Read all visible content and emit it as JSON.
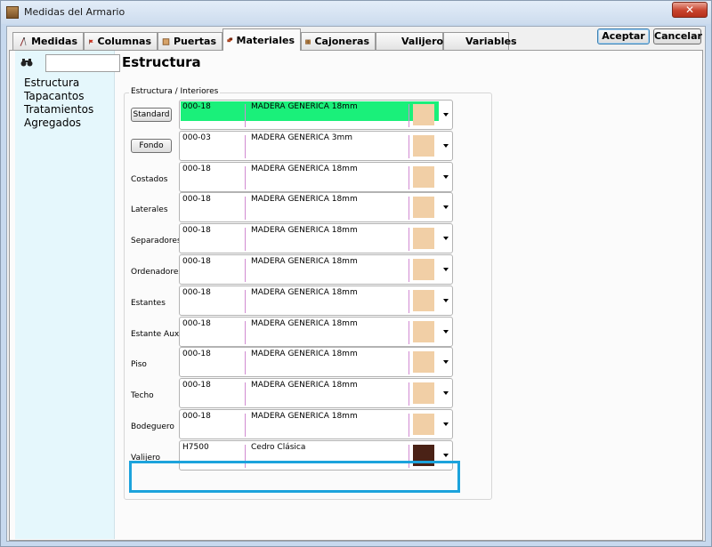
{
  "window": {
    "title": "Medidas del Armario",
    "close_glyph": "✕"
  },
  "tabs": [
    {
      "label": "Medidas",
      "icon": "compass-icon",
      "active": false
    },
    {
      "label": "Columnas",
      "icon": "flag-icon",
      "active": false
    },
    {
      "label": "Puertas",
      "icon": "door-icon",
      "active": false
    },
    {
      "label": "Materiales",
      "icon": "wood-icon",
      "active": true
    },
    {
      "label": "Cajoneras",
      "icon": "drawer-icon",
      "active": false
    },
    {
      "label": "Valijero",
      "icon": "",
      "active": false
    },
    {
      "label": "Variables",
      "icon": "",
      "active": false
    }
  ],
  "buttons": {
    "accept": "Aceptar",
    "cancel": "Cancelar"
  },
  "left_pane": {
    "search_icon": "binoculars-icon",
    "search_value": "",
    "tree_items": [
      "Estructura",
      "Tapacantos",
      "Tratamientos",
      "Agregados"
    ]
  },
  "section": {
    "title": "Estructura",
    "group_label": "Estructura / Interiores"
  },
  "rows": [
    {
      "label": "Standard",
      "is_button": true,
      "code": "000-18",
      "material": "MADERA GENERICA 18mm",
      "swatch": "#f1cfa6",
      "selected": true
    },
    {
      "label": "Fondo",
      "is_button": true,
      "code": "000-03",
      "material": "MADERA GENERICA 3mm",
      "swatch": "#f1cfa6",
      "selected": false
    },
    {
      "label": "Costados",
      "is_button": false,
      "code": "000-18",
      "material": "MADERA GENERICA 18mm",
      "swatch": "#f1cfa6",
      "selected": false
    },
    {
      "label": "Laterales",
      "is_button": false,
      "code": "000-18",
      "material": "MADERA GENERICA 18mm",
      "swatch": "#f1cfa6",
      "selected": false
    },
    {
      "label": "Separadores",
      "is_button": false,
      "code": "000-18",
      "material": "MADERA GENERICA 18mm",
      "swatch": "#f1cfa6",
      "selected": false
    },
    {
      "label": "Ordenadores",
      "is_button": false,
      "code": "000-18",
      "material": "MADERA GENERICA 18mm",
      "swatch": "#f1cfa6",
      "selected": false
    },
    {
      "label": "Estantes",
      "is_button": false,
      "code": "000-18",
      "material": "MADERA GENERICA 18mm",
      "swatch": "#f1cfa6",
      "selected": false
    },
    {
      "label": "Estante Aux.",
      "is_button": false,
      "code": "000-18",
      "material": "MADERA GENERICA 18mm",
      "swatch": "#f1cfa6",
      "selected": false
    },
    {
      "label": "Piso",
      "is_button": false,
      "code": "000-18",
      "material": "MADERA GENERICA 18mm",
      "swatch": "#f1cfa6",
      "selected": false
    },
    {
      "label": "Techo",
      "is_button": false,
      "code": "000-18",
      "material": "MADERA GENERICA 18mm",
      "swatch": "#f1cfa6",
      "selected": false
    },
    {
      "label": "Bodeguero",
      "is_button": false,
      "code": "000-18",
      "material": "MADERA GENERICA 18mm",
      "swatch": "#f1cfa6",
      "selected": false
    },
    {
      "label": "Valijero",
      "is_button": false,
      "code": "H7500",
      "material": "Cedro Clásica",
      "swatch": "#4a2216",
      "selected": false
    }
  ],
  "colors": {
    "selection_highlight": "#1af07a",
    "focus_ring": "#1ca3dc",
    "left_pane_bg": "#e5f7fc"
  }
}
